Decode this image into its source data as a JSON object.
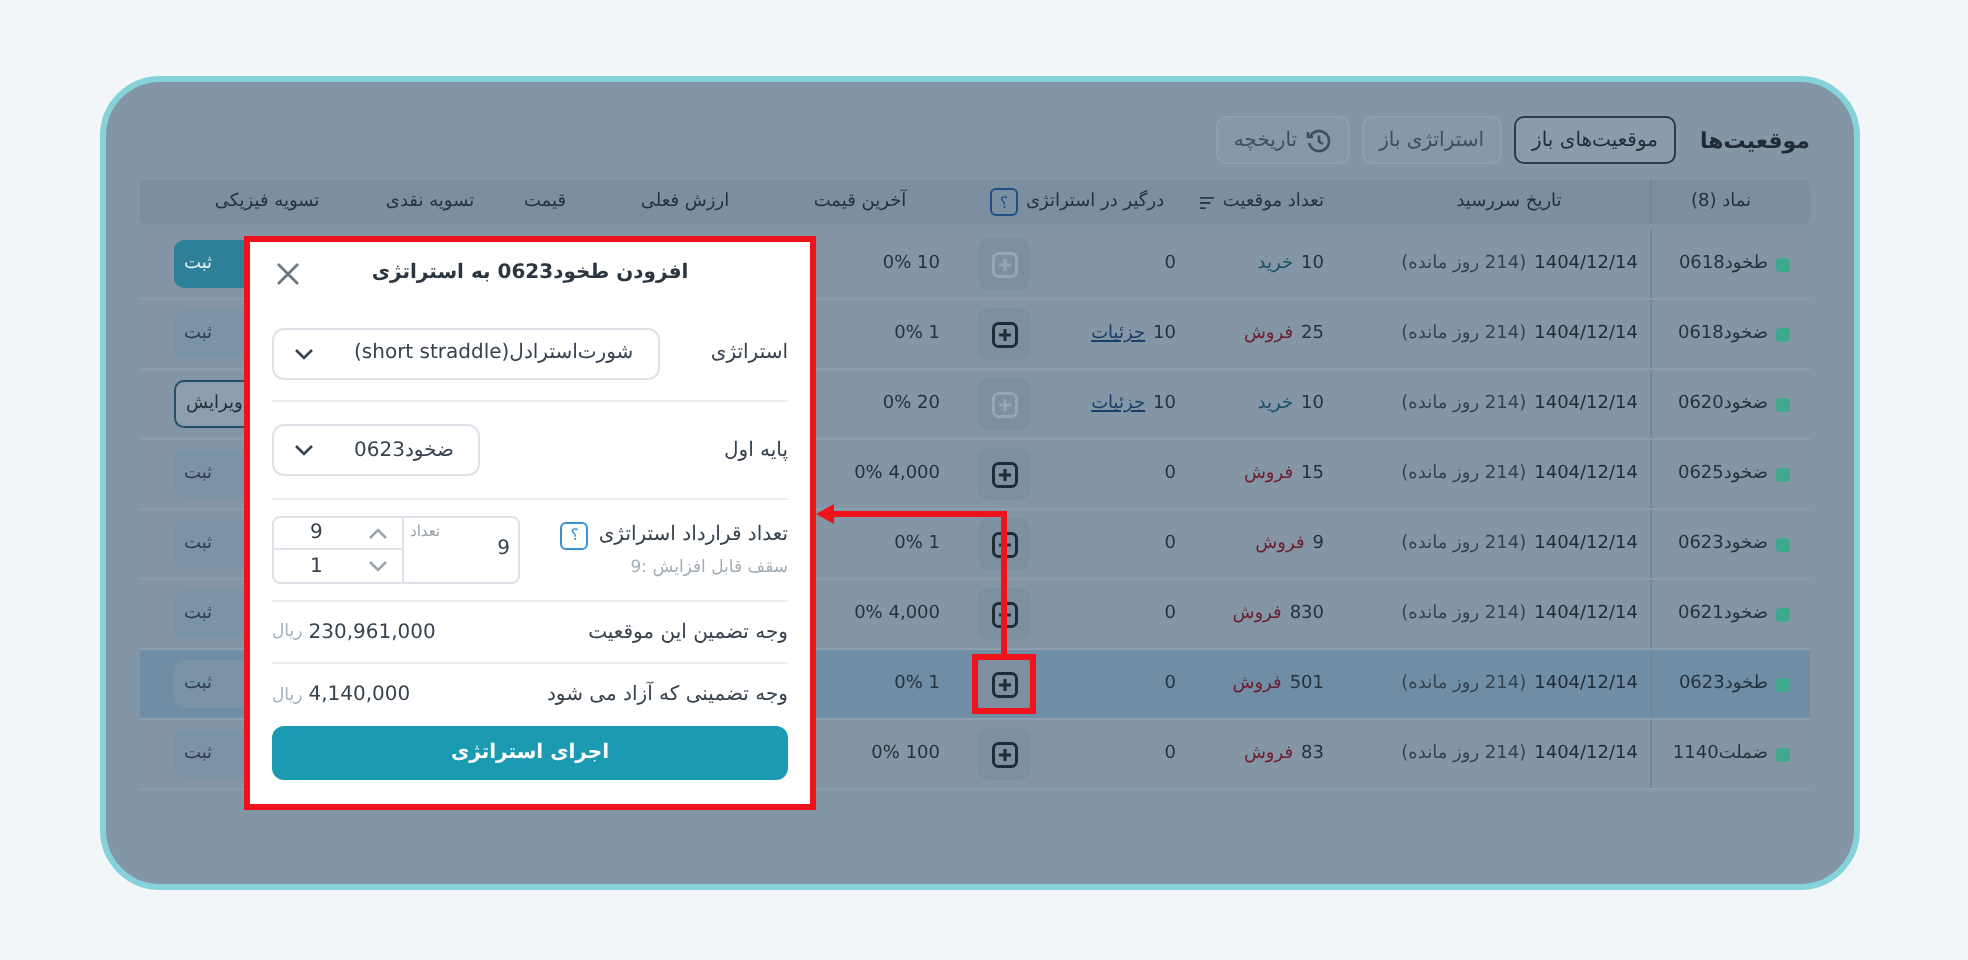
{
  "page": {
    "title": "موقعیت‌ها"
  },
  "tabs": [
    {
      "label": "موقعیت‌های باز",
      "selected": true,
      "kind": "text"
    },
    {
      "label": "استراتژی باز",
      "selected": false,
      "kind": "text"
    },
    {
      "label": "تاریخچه",
      "selected": false,
      "kind": "history"
    }
  ],
  "table": {
    "columns": [
      {
        "label": "نماد (8)",
        "kind": "plain"
      },
      {
        "label": "تاریخ سررسید",
        "kind": "plain"
      },
      {
        "label": "تعداد موقعیت",
        "kind": "sortable"
      },
      {
        "label": "درگیر در استراتژی",
        "kind": "help",
        "help_mark": "؟"
      },
      {
        "label": "آخرین قیمت",
        "kind": "plain"
      },
      {
        "label": "ارزش فعلی",
        "kind": "plain"
      },
      {
        "label": "قیمت",
        "kind": "plain"
      },
      {
        "label": "تسویه نقدی",
        "kind": "plain"
      },
      {
        "label": "تسویه فیزیکی",
        "kind": "plain"
      }
    ],
    "rows": [
      {
        "symbol": "طخود0618",
        "color": "#3fa98c",
        "date": "1404/12/14",
        "remaining": "(214 روز مانده)",
        "quantity": "10",
        "side": "خرید",
        "buy": true,
        "engaged": "0",
        "add_disabled": true,
        "last_price": "10 0%",
        "action": {
          "label": "ثبت",
          "kind": "primary"
        },
        "selected": false,
        "highlighted": false
      },
      {
        "symbol": "ضخود0618",
        "color": "#3fa98c",
        "date": "1404/12/14",
        "remaining": "(214 روز مانده)",
        "quantity": "25",
        "side": "فروش",
        "buy": false,
        "engaged": "10",
        "link": "جزئیات",
        "add_disabled": false,
        "last_price": "1 0%",
        "action": {
          "label": "ثبت",
          "kind": "faded"
        },
        "selected": false,
        "highlighted": false
      },
      {
        "symbol": "ضخود0620",
        "color": "#3fa98c",
        "date": "1404/12/14",
        "remaining": "(214 روز مانده)",
        "quantity": "10",
        "side": "خرید",
        "buy": true,
        "engaged": "10",
        "link": "جزئیات",
        "add_disabled": true,
        "last_price": "20 0%",
        "action": {
          "label": "ویرایش",
          "kind": "outline"
        },
        "selected": false,
        "highlighted": false
      },
      {
        "symbol": "ضخود0625",
        "color": "#3fa98c",
        "date": "1404/12/14",
        "remaining": "(214 روز مانده)",
        "quantity": "15",
        "side": "فروش",
        "buy": false,
        "engaged": "0",
        "add_disabled": false,
        "last_price": "4,000 0%",
        "action": {
          "label": "ثبت",
          "kind": "faded"
        },
        "selected": false,
        "highlighted": false
      },
      {
        "symbol": "ضخود0623",
        "color": "#3fa98c",
        "date": "1404/12/14",
        "remaining": "(214 روز مانده)",
        "quantity": "9",
        "side": "فروش",
        "buy": false,
        "engaged": "0",
        "add_disabled": false,
        "last_price": "1 0%",
        "action": {
          "label": "ثبت",
          "kind": "faded"
        },
        "selected": false,
        "highlighted": false
      },
      {
        "symbol": "ضخود0621",
        "color": "#3fa98c",
        "date": "1404/12/14",
        "remaining": "(214 روز مانده)",
        "quantity": "830",
        "side": "فروش",
        "buy": false,
        "engaged": "0",
        "add_disabled": false,
        "last_price": "4,000 0%",
        "action": {
          "label": "ثبت",
          "kind": "faded"
        },
        "selected": false,
        "highlighted": false
      },
      {
        "symbol": "طخود0623",
        "color": "#3fa98c",
        "date": "1404/12/14",
        "remaining": "(214 روز مانده)",
        "quantity": "501",
        "side": "فروش",
        "buy": false,
        "engaged": "0",
        "add_disabled": false,
        "last_price": "1 0%",
        "action": {
          "label": "ثبت",
          "kind": "faded"
        },
        "selected": true,
        "highlighted": true
      },
      {
        "symbol": "ضملت1140",
        "color": "#3fa98c",
        "date": "1404/12/14",
        "remaining": "(214 روز مانده)",
        "quantity": "83",
        "side": "فروش",
        "buy": false,
        "engaged": "0",
        "add_disabled": false,
        "last_price": "100 0%",
        "action": {
          "label": "ثبت",
          "kind": "faded"
        },
        "selected": false,
        "highlighted": false
      }
    ]
  },
  "dialog": {
    "title": "افزودن طخود0623 به استراتژی",
    "fields": [
      {
        "kind": "select",
        "label": "استراتژی",
        "value": "شورت‌استرادل(short straddle)"
      },
      {
        "kind": "select",
        "label": "پایه اول",
        "value": "ضخود0623"
      },
      {
        "kind": "quantity",
        "label": "تعداد قرارداد استراتژی",
        "help_mark": "؟",
        "hint": "سقف قابل افزایش :9",
        "input_label": "تعداد",
        "value": "9",
        "max": "9",
        "min": "1"
      },
      {
        "kind": "amount",
        "label": "وجه تضمین این موقعیت",
        "value": "230,961,000",
        "unit": "ریال"
      },
      {
        "kind": "amount",
        "label": "وجه تضمینی که آزاد می شود",
        "value": "4,140,000",
        "unit": "ریال"
      }
    ],
    "submit": "اجرای استراتژی"
  }
}
